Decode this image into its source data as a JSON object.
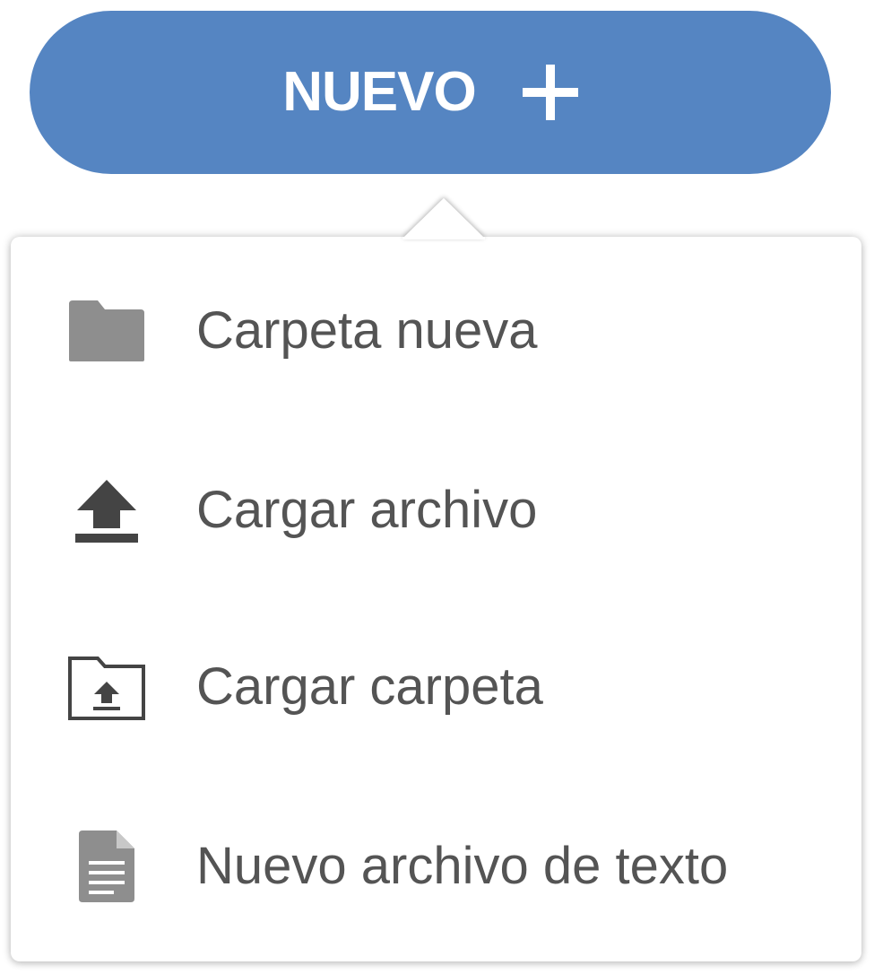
{
  "new_button": {
    "label": "NUEVO",
    "icon": "plus-icon",
    "color": "#5585c2"
  },
  "menu": {
    "items": [
      {
        "label": "Carpeta nueva",
        "icon": "folder-icon"
      },
      {
        "label": "Cargar archivo",
        "icon": "upload-icon"
      },
      {
        "label": "Cargar carpeta",
        "icon": "folder-upload-icon"
      },
      {
        "label": "Nuevo archivo de texto",
        "icon": "text-file-icon"
      }
    ]
  },
  "colors": {
    "icon_gray": "#8e8e8e",
    "icon_dark": "#444444",
    "text": "#545454"
  }
}
